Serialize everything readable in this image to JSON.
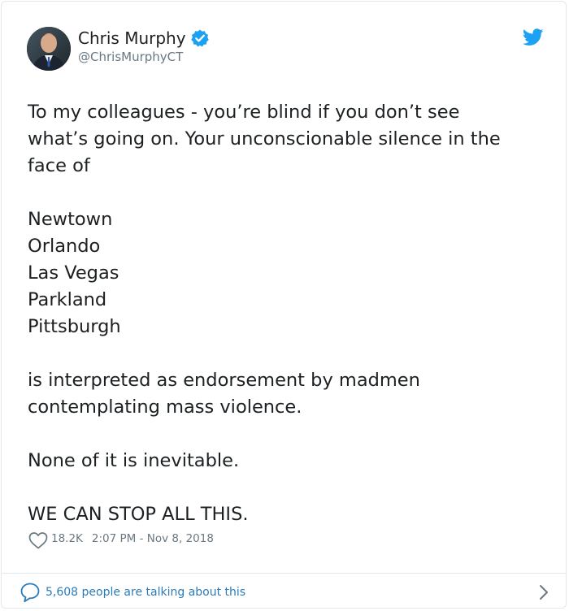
{
  "author": {
    "name": "Chris Murphy",
    "handle": "@ChrisMurphyCT",
    "verified_icon": "verified-badge-icon",
    "avatar": "avatar"
  },
  "brand": {
    "icon": "twitter-bird-icon",
    "color": "#1da1f2"
  },
  "tweet": {
    "lines": [
      "To my colleagues - you’re blind if you don’t see",
      "what’s going on. Your unconscionable silence in the",
      "face of",
      "",
      "Newtown",
      "Orlando",
      "Las Vegas",
      "Parkland",
      "Pittsburgh",
      "",
      "is interpreted as endorsement by madmen",
      "contemplating mass violence.",
      "",
      "None of it is inevitable.",
      "",
      "WE CAN STOP ALL THIS."
    ],
    "likes": "18.2K",
    "timestamp": "2:07 PM - Nov 8, 2018"
  },
  "footer": {
    "talking": "5,608 people are talking about this",
    "link_color": "#2b7bb9"
  },
  "colors": {
    "text": "#1c2022",
    "muted": "#697882",
    "border": "#e1e8ed"
  }
}
